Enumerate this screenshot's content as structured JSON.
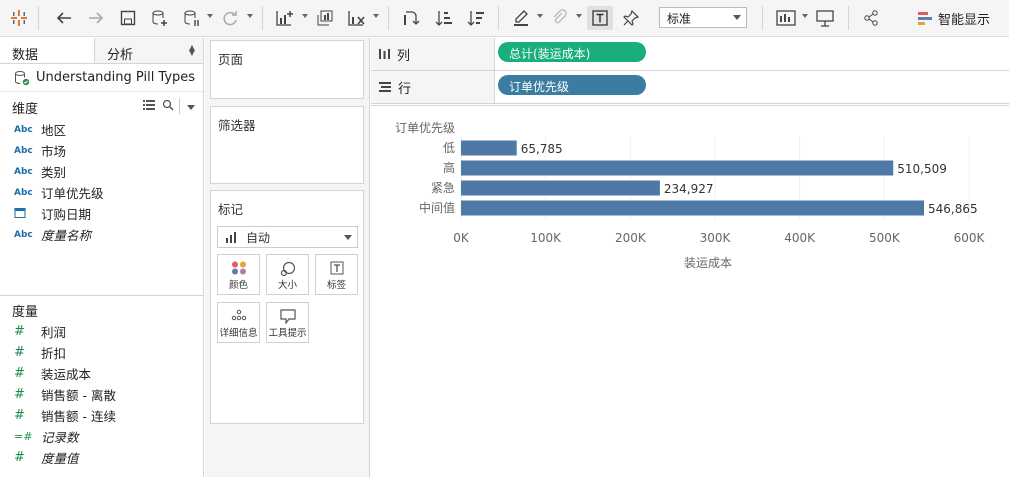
{
  "toolbar": {
    "fit_mode": "标准",
    "show_me_label": "智能显示"
  },
  "left_panel": {
    "tabs": [
      {
        "label": "数据"
      },
      {
        "label": "分析"
      }
    ],
    "data_source": "Understanding Pill Types",
    "dimensions_header": "维度",
    "dimensions": [
      {
        "type": "Abc",
        "label": "地区"
      },
      {
        "type": "Abc",
        "label": "市场"
      },
      {
        "type": "Abc",
        "label": "类别"
      },
      {
        "type": "Abc",
        "label": "订单优先级"
      },
      {
        "type": "date-icon",
        "label": "订购日期"
      },
      {
        "type": "Abc",
        "label": "度量名称"
      }
    ],
    "measures_header": "度量",
    "measures": [
      {
        "type": "#",
        "label": "利润"
      },
      {
        "type": "#",
        "label": "折扣"
      },
      {
        "type": "#",
        "label": "装运成本"
      },
      {
        "type": "#",
        "label": "销售额 - 离散"
      },
      {
        "type": "#",
        "label": "销售额 - 连续"
      },
      {
        "type": "=#",
        "label": "记录数"
      },
      {
        "type": "#",
        "label": "度量值"
      }
    ]
  },
  "cards": {
    "pages_title": "页面",
    "filters_title": "筛选器",
    "marks_title": "标记",
    "mark_type": "自动",
    "mark_buttons": [
      {
        "label": "颜色",
        "icon": "color-icon"
      },
      {
        "label": "大小",
        "icon": "size-icon"
      },
      {
        "label": "标签",
        "icon": "label-icon"
      },
      {
        "label": "详细信息",
        "icon": "detail-icon"
      },
      {
        "label": "工具提示",
        "icon": "tooltip-icon"
      }
    ]
  },
  "shelves": {
    "columns_label": "列",
    "columns_pill": "总计(装运成本)",
    "columns_pill_color": "#1aae7c",
    "rows_label": "行",
    "rows_pill": "订单优先级",
    "rows_pill_color": "#3a7da0"
  },
  "chart_data": {
    "type": "bar",
    "orientation": "horizontal",
    "row_header": "订单优先级",
    "categories": [
      "低",
      "高",
      "紧急",
      "中间值"
    ],
    "values": [
      65785,
      510509,
      234927,
      546865
    ],
    "value_labels": [
      "65,785",
      "510,509",
      "234,927",
      "546,865"
    ],
    "xlabel": "装运成本",
    "xlim": [
      0,
      600000
    ],
    "x_ticks": [
      0,
      100000,
      200000,
      300000,
      400000,
      500000,
      600000
    ],
    "x_tick_labels": [
      "0K",
      "100K",
      "200K",
      "300K",
      "400K",
      "500K",
      "600K"
    ],
    "bar_color": "#4e79a7",
    "grid": true
  }
}
